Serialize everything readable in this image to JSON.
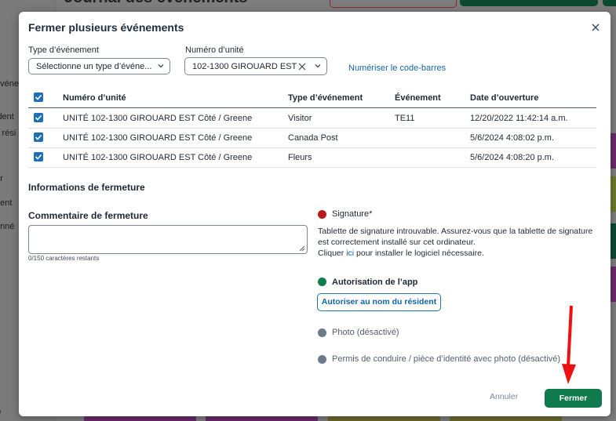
{
  "background": {
    "page_title": "Journal des événements",
    "sidebar_fragments": [
      "événe",
      "ident",
      "s rési",
      "e",
      "er",
      "dent",
      "onné",
      "té"
    ]
  },
  "modal": {
    "title": "Fermer plusieurs événements",
    "event_type": {
      "label": "Type d’événement",
      "value": "Sélectionne un type d’événe..."
    },
    "unit_number": {
      "label": "Numéro d’unité",
      "value": "102-1300 GIROUARD EST"
    },
    "scan_barcode_link": "Numériser le code-barres",
    "table": {
      "headers": [
        "Numéro d’unité",
        "Type d’événement",
        "Événement",
        "Date d’ouverture"
      ],
      "rows": [
        {
          "unit": "UNITÉ 102-1300 GIROUARD EST Côté / Greene",
          "type": "Visitor",
          "event": "TE11",
          "date": "12/20/2022 11:42:14 a.m."
        },
        {
          "unit": "UNITÉ 102-1300 GIROUARD EST Côté / Greene",
          "type": "Canada Post",
          "event": "",
          "date": "5/6/2024 4:08:02 p.m."
        },
        {
          "unit": "UNITÉ 102-1300 GIROUARD EST Côté / Greene",
          "type": "Fleurs",
          "event": "",
          "date": "5/6/2024 4:08:20 p.m."
        }
      ]
    },
    "closing_info_title": "Informations de fermeture",
    "comment_label": "Commentaire de fermeture",
    "comment_counter": "0/150 caractères restants",
    "signature": {
      "label": "Signature*",
      "color": "#b71c1c",
      "line1": "Tablette de signature introuvable. Assurez-vous que la tablette de signature est correctement installé sur cet ordinateur.",
      "line2_prefix": "Cliquer ",
      "line2_link": "ici",
      "line2_suffix": " pour installer le logiciel nécessaire."
    },
    "app_auth": {
      "label": "Autorisation de l’app",
      "color": "#0f7a4c",
      "button": "Autoriser au nom du résident"
    },
    "photo": {
      "label": "Photo (désactivé)",
      "color": "#6b7b8a"
    },
    "license": {
      "label": "Permis de conduire / pièce d’identité avec photo (désactivé)",
      "color": "#6b7b8a"
    },
    "cancel_label": "Annuler",
    "close_label": "Fermer",
    "accent_color": "#0f7a4c"
  }
}
